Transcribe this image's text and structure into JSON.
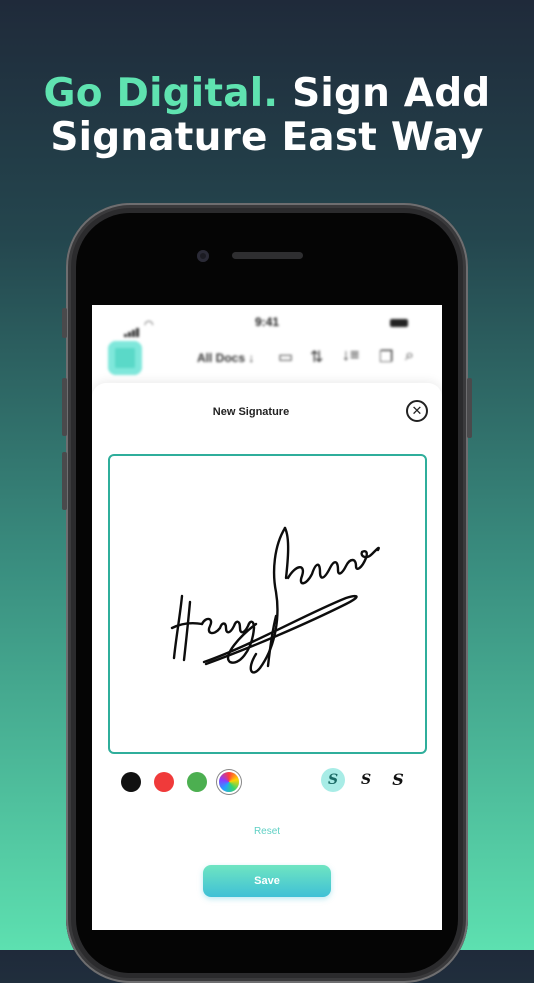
{
  "headline": {
    "accent": "Go Digital.",
    "rest_line1": " Sign Add",
    "line2": "Signature East Way"
  },
  "status_bar": {
    "time": "9:41"
  },
  "app_bar": {
    "filter_label": "All Docs"
  },
  "modal": {
    "title": "New Signature",
    "signature_text": "Henry James",
    "colors": [
      "#111111",
      "#f03a3a",
      "#4caf50"
    ],
    "reset_label": "Reset",
    "save_label": "Save",
    "pen_icon_glyph": "S"
  },
  "colors": {
    "accent": "#5fe3b0",
    "pad_border": "#2fae9b",
    "save_button": "#3fc0d6"
  }
}
